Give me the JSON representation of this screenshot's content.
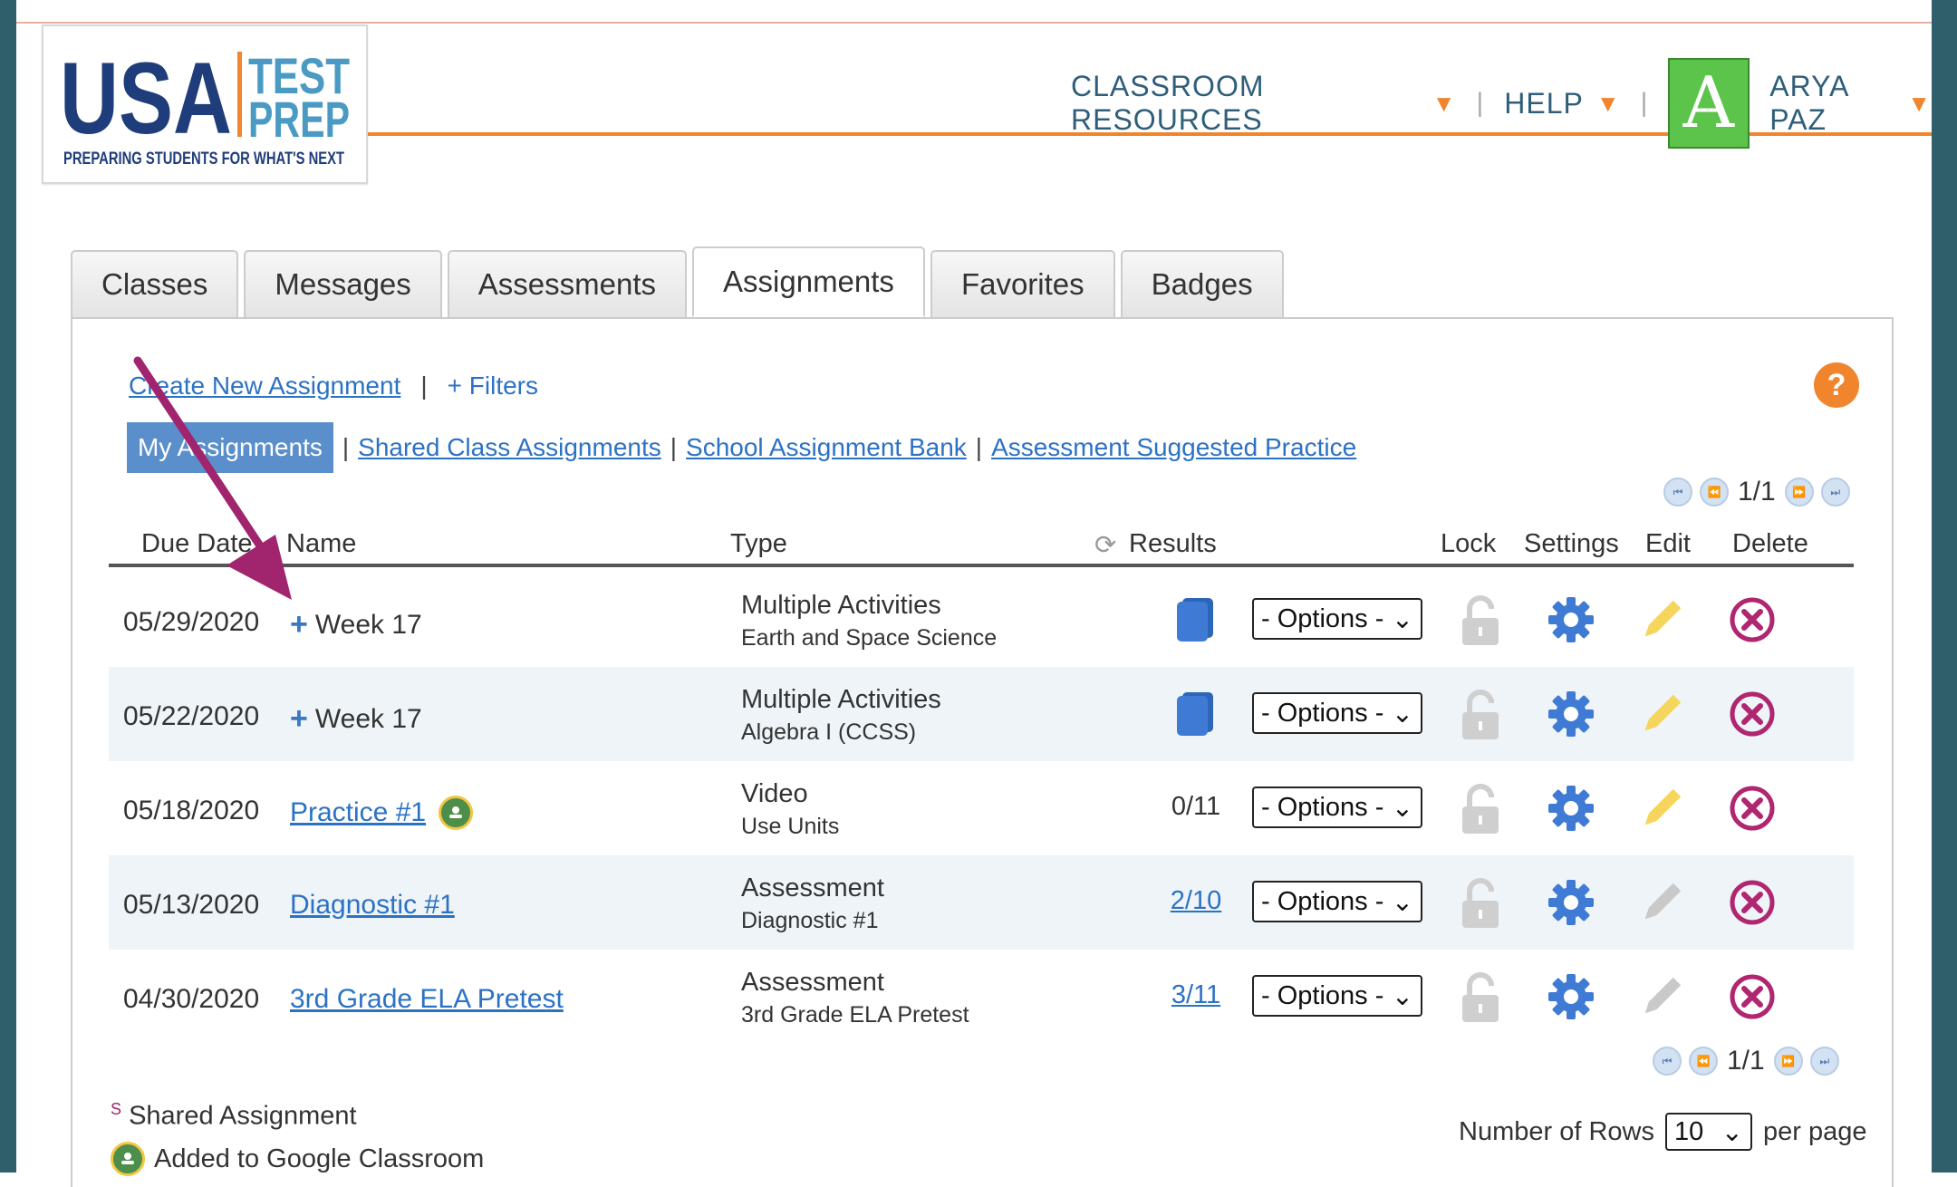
{
  "logo": {
    "usa": "USA",
    "test": "TEST",
    "prep": "PREP",
    "tagline": "PREPARING STUDENTS FOR WHAT'S NEXT"
  },
  "nav": {
    "classroom_resources": "CLASSROOM RESOURCES",
    "help": "HELP",
    "avatar_letter": "A",
    "user_name": "ARYA PAZ"
  },
  "tabs": [
    {
      "label": "Classes"
    },
    {
      "label": "Messages"
    },
    {
      "label": "Assessments"
    },
    {
      "label": "Assignments"
    },
    {
      "label": "Favorites"
    },
    {
      "label": "Badges"
    }
  ],
  "actions": {
    "create": "Create New Assignment",
    "filters": "+ Filters",
    "help_icon": "?"
  },
  "subtabs": {
    "mine": "My Assignments",
    "shared": "Shared Class Assignments",
    "bank": "School Assignment Bank",
    "suggested": "Assessment Suggested Practice"
  },
  "pager": {
    "top": "1/1",
    "bottom": "1/1"
  },
  "table": {
    "headers": {
      "due_date": "Due Date",
      "name": "Name",
      "type": "Type",
      "results": "Results",
      "lock": "Lock",
      "settings": "Settings",
      "edit": "Edit",
      "delete": "Delete"
    },
    "rows": [
      {
        "date": "05/29/2020",
        "name": "Week 17",
        "type": "Multiple Activities",
        "subtype": "Earth and Space Science",
        "result": "",
        "options": "- Options -"
      },
      {
        "date": "05/22/2020",
        "name": "Week 17",
        "type": "Multiple Activities",
        "subtype": "Algebra I (CCSS)",
        "result": "",
        "options": "- Options -"
      },
      {
        "date": "05/18/2020",
        "name": "Practice #1 ",
        "type": "Video",
        "subtype": "Use Units",
        "result": "0/11",
        "options": "- Options -"
      },
      {
        "date": "05/13/2020",
        "name": "Diagnostic #1",
        "type": "Assessment",
        "subtype": "Diagnostic #1",
        "result": "2/10",
        "options": "- Options -"
      },
      {
        "date": "04/30/2020",
        "name": "3rd Grade ELA Pretest",
        "type": "Assessment",
        "subtype": "3rd Grade ELA Pretest",
        "result": "3/11",
        "options": "- Options -"
      }
    ]
  },
  "legend": {
    "shared_marker": "S",
    "shared": "Shared Assignment",
    "google": "Added to Google Classroom"
  },
  "rows_control": {
    "label": "Number of Rows",
    "value": "10",
    "suffix": "per page"
  },
  "colors": {
    "accent_orange": "#f0852d",
    "link_blue": "#2c72c4",
    "annotation_arrow": "#a0246e",
    "avatar_green": "#5cc44a"
  }
}
